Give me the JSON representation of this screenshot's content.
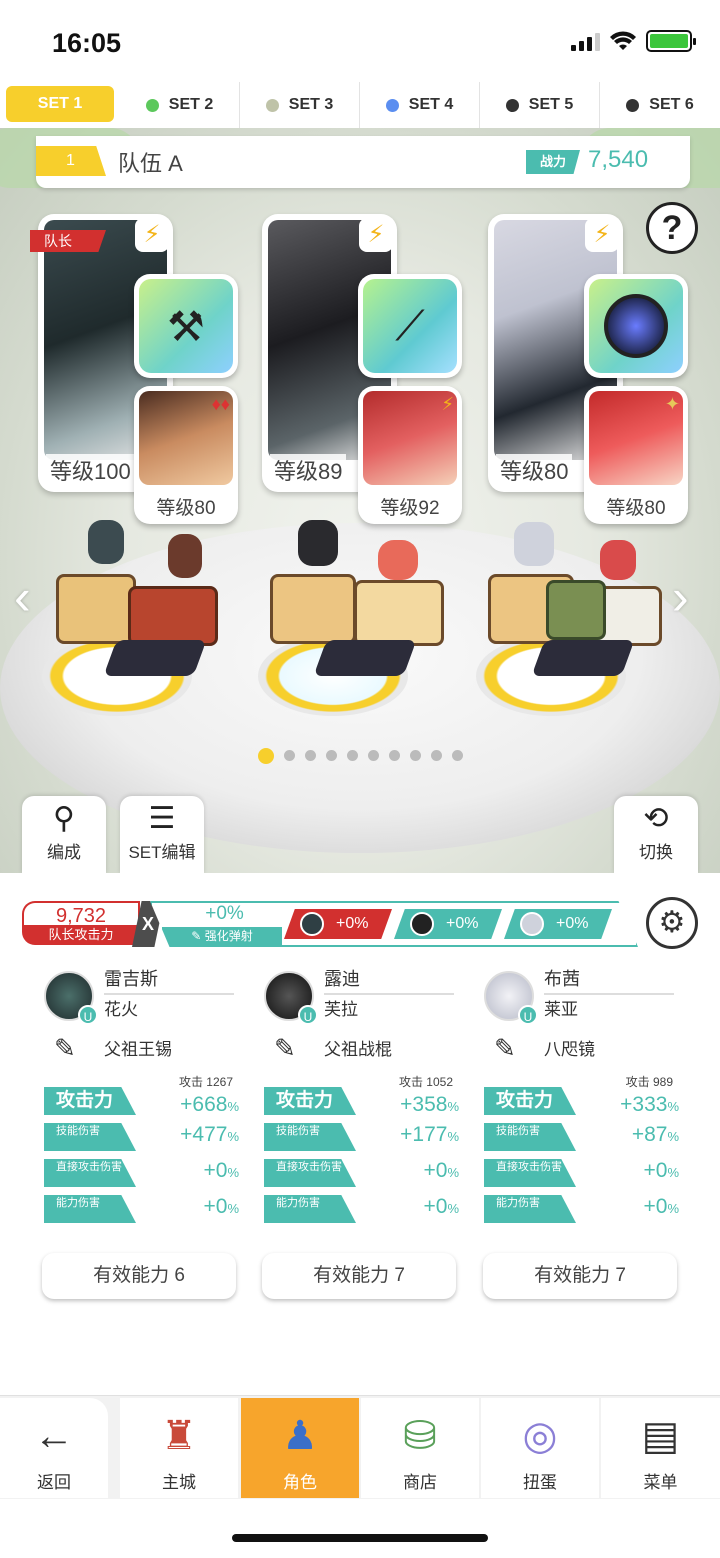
{
  "status_bar": {
    "time": "16:05"
  },
  "set_tabs": [
    {
      "label": "SET 1",
      "dot": "",
      "active": true
    },
    {
      "label": "SET 2",
      "dot": "#5cc85c",
      "active": false
    },
    {
      "label": "SET 3",
      "dot": "#bfc3a8",
      "active": false
    },
    {
      "label": "SET 4",
      "dot": "#5b8ef0",
      "active": false
    },
    {
      "label": "SET 5",
      "dot": "#333333",
      "active": false
    },
    {
      "label": "SET 6",
      "dot": "#333333",
      "active": false
    }
  ],
  "team": {
    "number": "1",
    "name": "队伍 A",
    "power_label": "战力",
    "power_value": "7,540"
  },
  "help_label": "?",
  "leader_tag": "队长",
  "heroes": [
    {
      "level": "等级100",
      "acc_level": "等级80",
      "weapon_icon": "hammer-icon",
      "weapon_glyph": "⚒"
    },
    {
      "level": "等级89",
      "acc_level": "等级92",
      "weapon_icon": "staff-icon",
      "weapon_glyph": "⟋"
    },
    {
      "level": "等级80",
      "acc_level": "等级80",
      "weapon_icon": "mirror-icon",
      "weapon_glyph": "◉"
    }
  ],
  "pager": {
    "total": 10,
    "current": 1
  },
  "side_buttons": {
    "formation": "编成",
    "set_edit": "SET编辑",
    "switch": "切换"
  },
  "boost": {
    "leader_atk_value": "9,732",
    "leader_atk_label": "队长攻击力",
    "x": "X",
    "enhance_value": "+0%",
    "enhance_label": "强化弹射",
    "chips": [
      "+0%",
      "+0%",
      "+0%"
    ]
  },
  "stat_labels": {
    "atk": "攻击力",
    "skill": "技能伤害",
    "direct": "直接攻击伤害",
    "ability": "能力伤害"
  },
  "columns": [
    {
      "hero": "雷吉斯",
      "acc": "花火",
      "weapon": "父祖王锡",
      "base_atk": "攻击 1267",
      "atk": "+668",
      "skill": "+477",
      "direct": "+0",
      "ability": "+0",
      "effective": "有效能力 6"
    },
    {
      "hero": "露迪",
      "acc": "芙拉",
      "weapon": "父祖战棍",
      "base_atk": "攻击 1052",
      "atk": "+358",
      "skill": "+177",
      "direct": "+0",
      "ability": "+0",
      "effective": "有效能力 7"
    },
    {
      "hero": "布茜",
      "acc": "莱亚",
      "weapon": "八咫镜",
      "base_atk": "攻击 989",
      "atk": "+333",
      "skill": "+87",
      "direct": "+0",
      "ability": "+0",
      "effective": "有效能力 7"
    }
  ],
  "pct": "%",
  "bottom_nav": [
    {
      "label": "返回",
      "icon": "back-arrow-icon"
    },
    {
      "label": "主城",
      "icon": "castle-icon"
    },
    {
      "label": "角色",
      "icon": "character-icon",
      "active": true
    },
    {
      "label": "商店",
      "icon": "shop-icon"
    },
    {
      "label": "扭蛋",
      "icon": "gacha-icon"
    },
    {
      "label": "菜单",
      "icon": "menu-icon"
    }
  ],
  "colors": {
    "accent_teal": "#4bbcaf",
    "accent_yellow": "#f7cf2c",
    "accent_red": "#d2302f",
    "nav_active": "#f7a52c"
  }
}
